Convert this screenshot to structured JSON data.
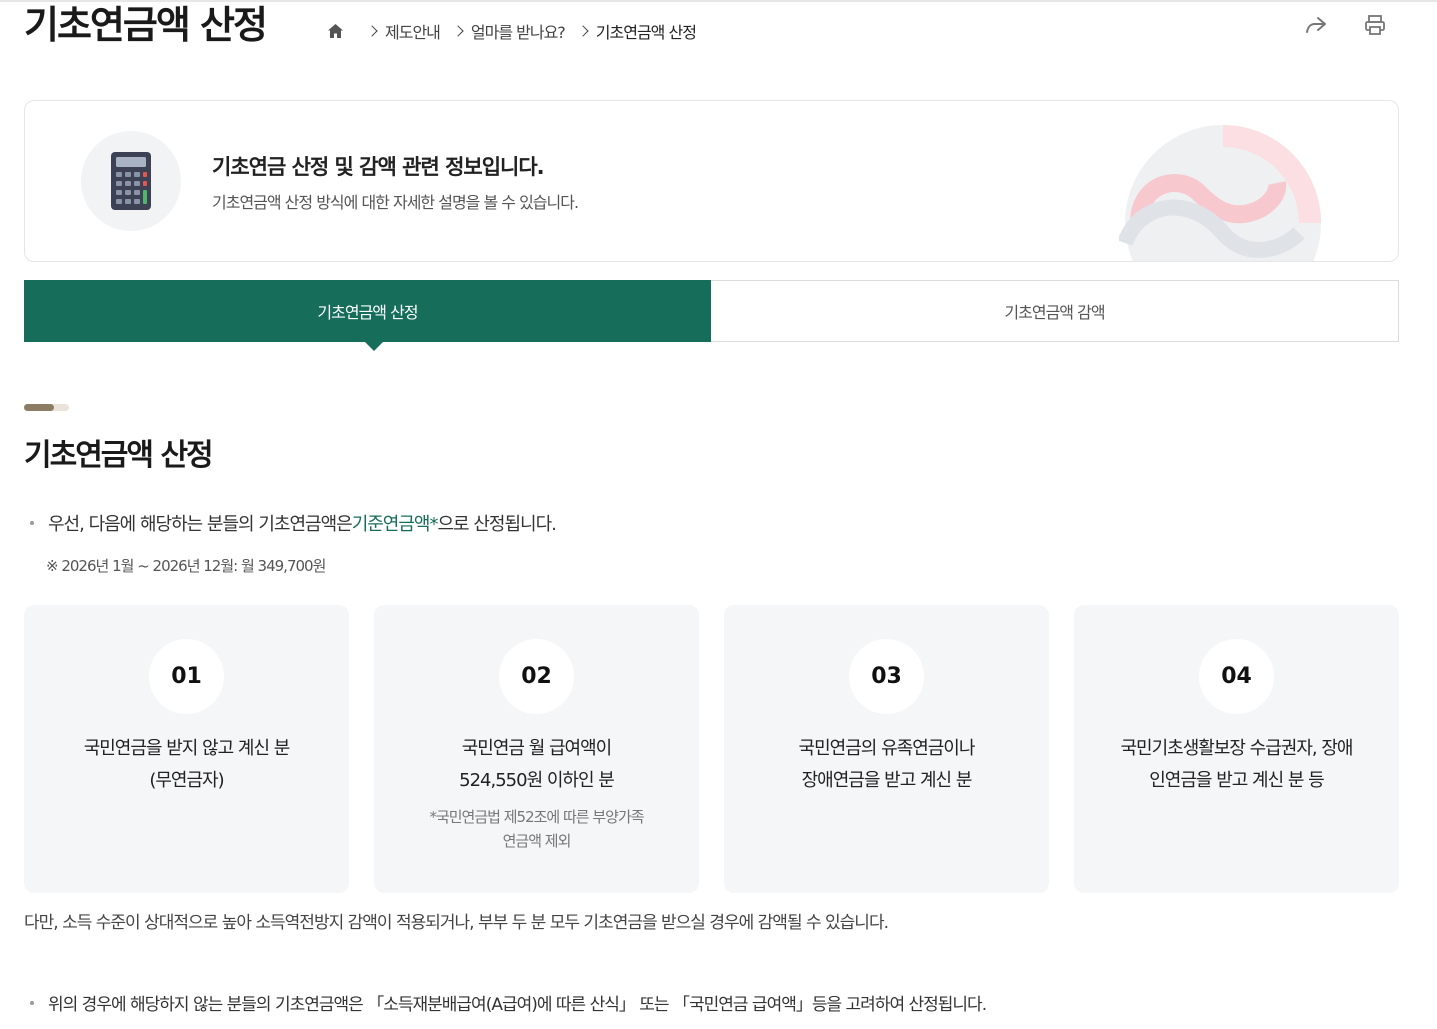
{
  "page": {
    "title": "기초연금액 산정"
  },
  "breadcrumb": {
    "items": [
      "제도안내",
      "얼마를 받나요?",
      "기초연금액 산정"
    ]
  },
  "info_box": {
    "title": "기초연금 산정 및 감액 관련 정보입니다.",
    "description": "기초연금액 산정 방식에 대한 자세한 설명을 볼 수 있습니다."
  },
  "tabs": [
    {
      "label": "기초연금액 산정",
      "active": true
    },
    {
      "label": "기초연금액 감액",
      "active": false
    }
  ],
  "section": {
    "title": "기초연금액 산정",
    "bullet1_prefix": "우선, 다음에 해당하는 분들의 기초연금액은 ",
    "bullet1_link": "기준연금액*",
    "bullet1_suffix": "으로 산정됩니다.",
    "note": "※ 2026년 1월 ~ 2026년 12월: 월 349,700원"
  },
  "cards": [
    {
      "num": "01",
      "line1": "국민연금을 받지 않고 계신 분",
      "line2": "(무연금자)",
      "sub1": "",
      "sub2": ""
    },
    {
      "num": "02",
      "line1": "국민연금 월 급여액이",
      "line2": "524,550원 이하인 분",
      "sub1": "*국민연금법 제52조에 따른 부양가족",
      "sub2": "연금액 제외"
    },
    {
      "num": "03",
      "line1": "국민연금의 유족연금이나",
      "line2": "장애연금을 받고 계신 분",
      "sub1": "",
      "sub2": ""
    },
    {
      "num": "04",
      "line1": "국민기초생활보장 수급권자, 장애",
      "line2": "인연금을 받고 계신 분 등",
      "sub1": "",
      "sub2": ""
    }
  ],
  "footnote": "다만, 소득 수준이 상대적으로 높아 소득역전방지 감액이 적용되거나, 부부 두 분 모두 기초연금을 받으실 경우에 감액될 수 있습니다.",
  "bullet2": "위의 경우에 해당하지 않는 분들의 기초연금액은 「소득재분배급여(A급여)에 따른 산식」 또는 「국민연금 급여액」등을 고려하여 산정됩니다.",
  "colors": {
    "primary_green": "#156d5a",
    "accent_brown": "#8c7c63"
  },
  "icons": {
    "home": "home-icon",
    "share": "share-icon",
    "print": "print-icon",
    "calculator": "calculator-icon"
  }
}
